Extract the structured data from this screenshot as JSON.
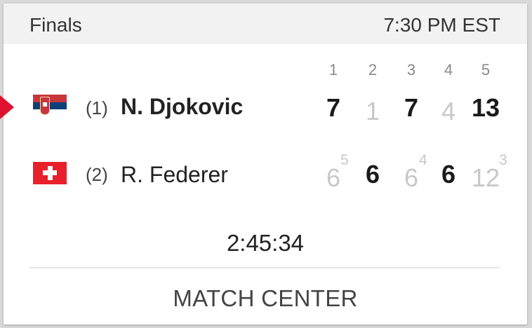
{
  "header": {
    "round": "Finals",
    "time": "7:30 PM EST"
  },
  "sets": {
    "labels": [
      "1",
      "2",
      "3",
      "4",
      "5"
    ]
  },
  "players": [
    {
      "seed": "(1)",
      "name": "N. Djokovic",
      "country_flag_icon": "serbia-flag-icon",
      "serving": true,
      "winner": true,
      "scores": [
        "7",
        "1",
        "7",
        "4",
        "13"
      ],
      "tiebreaks": [
        "",
        "",
        "",
        "",
        ""
      ]
    },
    {
      "seed": "(2)",
      "name": "R. Federer",
      "country_flag_icon": "switzerland-flag-icon",
      "serving": false,
      "winner": false,
      "scores": [
        "6",
        "6",
        "6",
        "6",
        "12"
      ],
      "tiebreaks": [
        "5",
        "",
        "4",
        "",
        "3"
      ]
    }
  ],
  "match": {
    "duration": "2:45:34",
    "match_center_label": "MATCH CENTER"
  },
  "colors": {
    "accent": "#e0102f",
    "header_bg": "#f2f2f2",
    "winning_score": "#1a1a1a",
    "losing_score": "#c8c8c8"
  }
}
